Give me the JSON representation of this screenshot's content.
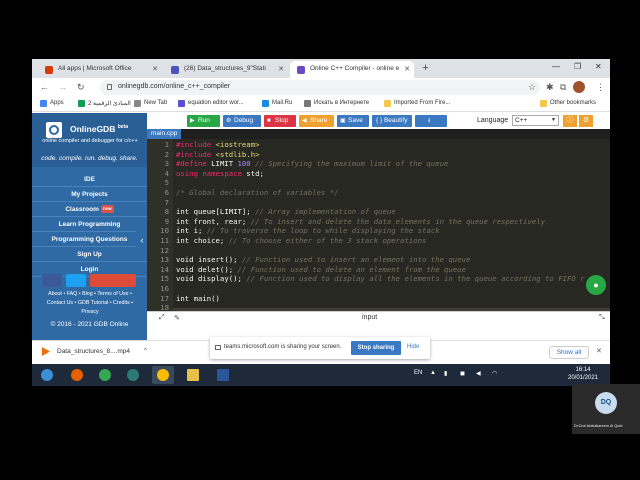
{
  "browser": {
    "tabs": [
      {
        "title": "All apps | Microsoft Office",
        "color": "#d83b01"
      },
      {
        "title": "(26) Data_structures_9\"Stati",
        "color": "#4b53bc"
      },
      {
        "title": "Online C++ Compiler - online e",
        "color": "#6a4bc4"
      }
    ],
    "url": "onlinegdb.com/online_c++_compiler",
    "bookmarks": [
      {
        "label": "Apps",
        "color": "#4285f4"
      },
      {
        "label": "2 المبادئ الرقمية",
        "color": "#0f9d58"
      },
      {
        "label": "New Tab",
        "color": "#888888"
      },
      {
        "label": "equation editor wor...",
        "color": "#5a4fcf"
      },
      {
        "label": "Mail.Ru",
        "color": "#168de2"
      },
      {
        "label": "Искать в Интернете",
        "color": "#777777"
      },
      {
        "label": "Imported From Fire...",
        "color": "#f2c94c"
      },
      {
        "label": "Other bookmarks",
        "color": "#f2c94c"
      }
    ]
  },
  "sidebar": {
    "brand": "OnlineGDB",
    "brand_sup": "beta",
    "subtitle": "online compiler and debugger for c/c++",
    "tagline": "code. compile. run. debug. share.",
    "links": [
      "IDE",
      "My Projects",
      "Classroom",
      "Learn Programming",
      "Programming Questions",
      "Sign Up",
      "Login"
    ],
    "classroom_badge": "new",
    "footer1": "About • FAQ • Blog • Terms of Use •",
    "footer2": "Contact Us • GDB Tutorial • Credits •",
    "footer3": "Privacy",
    "copyright": "© 2016 - 2021 GDB Online"
  },
  "toolbar": {
    "run": "Run",
    "debug": "Debug",
    "stop": "Stop",
    "share": "Share",
    "save": "Save",
    "beautify": "{ } Beautify",
    "language_label": "Language",
    "language_value": "C++"
  },
  "file_tab": "main.cpp",
  "code_lines": [
    {
      "n": "1",
      "segs": [
        [
          "pp",
          "#include "
        ],
        [
          "inc",
          "<iostream>"
        ]
      ]
    },
    {
      "n": "2",
      "segs": [
        [
          "pp",
          "#include "
        ],
        [
          "inc",
          "<stdlib.h>"
        ]
      ]
    },
    {
      "n": "3",
      "segs": [
        [
          "pp",
          "#define "
        ],
        [
          "id",
          "LIMIT "
        ],
        [
          "num",
          "100 "
        ],
        [
          "cm",
          "// Specifying the maximum limit of the queue"
        ]
      ]
    },
    {
      "n": "4",
      "segs": [
        [
          "kw",
          "using namespace "
        ],
        [
          "id",
          "std;"
        ]
      ]
    },
    {
      "n": "5",
      "segs": []
    },
    {
      "n": "6",
      "segs": [
        [
          "cm",
          "/* Global declaration of variables */"
        ]
      ]
    },
    {
      "n": "7",
      "segs": []
    },
    {
      "n": "8",
      "segs": [
        [
          "id",
          "int queue[LIMIT]; "
        ],
        [
          "cm",
          "// Array implementation of queue"
        ]
      ]
    },
    {
      "n": "9",
      "segs": [
        [
          "id",
          "int front, rear; "
        ],
        [
          "cm",
          "// To insert and delete the data elements in the queue respectively"
        ]
      ]
    },
    {
      "n": "10",
      "segs": [
        [
          "id",
          "int i; "
        ],
        [
          "cm",
          "// To traverse the loop to while displaying the stack"
        ]
      ]
    },
    {
      "n": "11",
      "segs": [
        [
          "id",
          "int choice; "
        ],
        [
          "cm",
          "// To choose either of the 3 stack operations"
        ]
      ]
    },
    {
      "n": "12",
      "segs": []
    },
    {
      "n": "13",
      "segs": [
        [
          "id",
          "void insert(); "
        ],
        [
          "cm",
          "// Function used to insert an element into the queue"
        ]
      ]
    },
    {
      "n": "14",
      "segs": [
        [
          "id",
          "void delet(); "
        ],
        [
          "cm",
          "// Function used to delete an element from the queue"
        ]
      ]
    },
    {
      "n": "15",
      "segs": [
        [
          "id",
          "void display(); "
        ],
        [
          "cm",
          "// Function used to display all the elements in the queue according to FIFO r"
        ]
      ]
    },
    {
      "n": "16",
      "segs": []
    },
    {
      "n": "17",
      "segs": [
        [
          "id",
          "int main()"
        ]
      ]
    },
    {
      "n": "18",
      "segs": []
    }
  ],
  "bottom_panel": {
    "input_label": "input"
  },
  "download": {
    "file": "Data_structures_8....mp4",
    "show_all": "Show all"
  },
  "share_bar": {
    "text": "teams.microsoft.com is sharing your screen.",
    "stop": "Stop sharing",
    "hide": "Hide"
  },
  "taskbar": {
    "lang": "EN",
    "time": "16:14",
    "date": "20/01/2021"
  },
  "webcam": {
    "initials": "DQ",
    "name": "Dr.Duri Abdulkareem Al Quid"
  }
}
